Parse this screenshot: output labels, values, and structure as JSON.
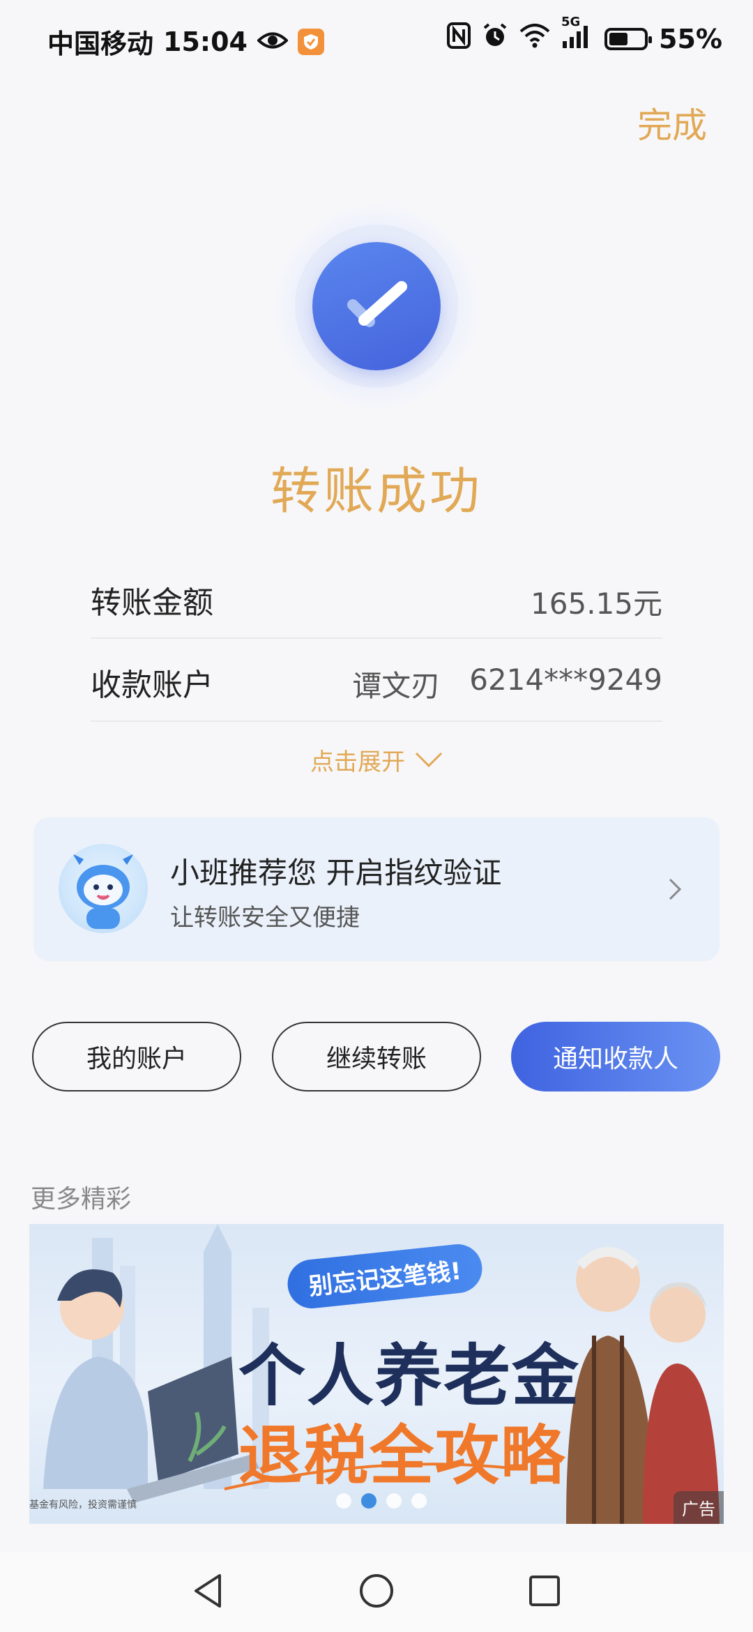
{
  "status_bar": {
    "carrier": "中国移动",
    "time": "15:04",
    "network": "5G",
    "battery_text": "55%",
    "battery_level": 0.55
  },
  "header": {
    "done_label": "完成"
  },
  "result": {
    "title": "转账成功"
  },
  "details": {
    "amount_label": "转账金额",
    "amount_value": "165.15元",
    "payee_label": "收款账户",
    "payee_name": "谭文刃",
    "payee_account": "6214***9249",
    "expand_label": "点击展开"
  },
  "promo": {
    "title": "小班推荐您 开启指纹验证",
    "subtitle": "让转账安全又便捷"
  },
  "actions": {
    "my_account": "我的账户",
    "continue_transfer": "继续转账",
    "notify_payee": "通知收款人"
  },
  "more": {
    "label": "更多精彩"
  },
  "banner": {
    "tag": "别忘记这笔钱!",
    "headline1": "个人养老金",
    "headline2": "退税全攻略",
    "disclaimer": "基金有风险，投资需谨慎",
    "ad_label": "广告",
    "dot_count": 4,
    "active_dot": 1
  },
  "colors": {
    "accent_gold": "#e1a855",
    "primary_blue": "#4563dc",
    "banner_orange": "#f0782a"
  },
  "icons": [
    "eye-icon",
    "shield-badge-icon",
    "nfc-icon",
    "alarm-icon",
    "wifi-icon",
    "signal-icon",
    "battery-icon",
    "check-icon",
    "chevron-down-icon",
    "chevron-right-icon",
    "back-nav-icon",
    "home-nav-icon",
    "recents-nav-icon"
  ]
}
